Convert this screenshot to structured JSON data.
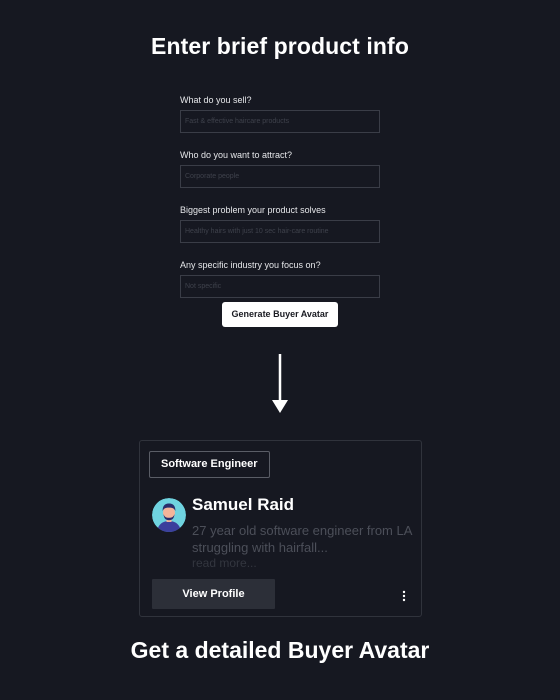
{
  "heading": "Enter brief product info",
  "form": {
    "fields": [
      {
        "label": "What do you sell?",
        "placeholder": "Fast & effective haircare products"
      },
      {
        "label": "Who do you want to attract?",
        "placeholder": "Corporate people"
      },
      {
        "label": "Biggest problem your product solves",
        "placeholder": "Healthy hairs with just 10 sec hair-care routine"
      },
      {
        "label": "Any specific industry you focus on?",
        "placeholder": "Not specific"
      }
    ],
    "generate_label": "Generate Buyer Avatar"
  },
  "arrow_icon": "arrow-down-icon",
  "card": {
    "role": "Software Engineer",
    "name": "Samuel Raid",
    "description": "27 year old software engineer from LA struggling with hairfall...",
    "read_more": "read more...",
    "view_profile_label": "View Profile",
    "avatar_icon": "person-avatar",
    "menu_icon": "more-vertical-icon"
  },
  "footer": "Get a detailed Buyer Avatar",
  "colors": {
    "background": "#161821",
    "button_light": "#ffffff",
    "button_dark": "#2c2f38",
    "avatar_bg": "#6fd3e0"
  }
}
